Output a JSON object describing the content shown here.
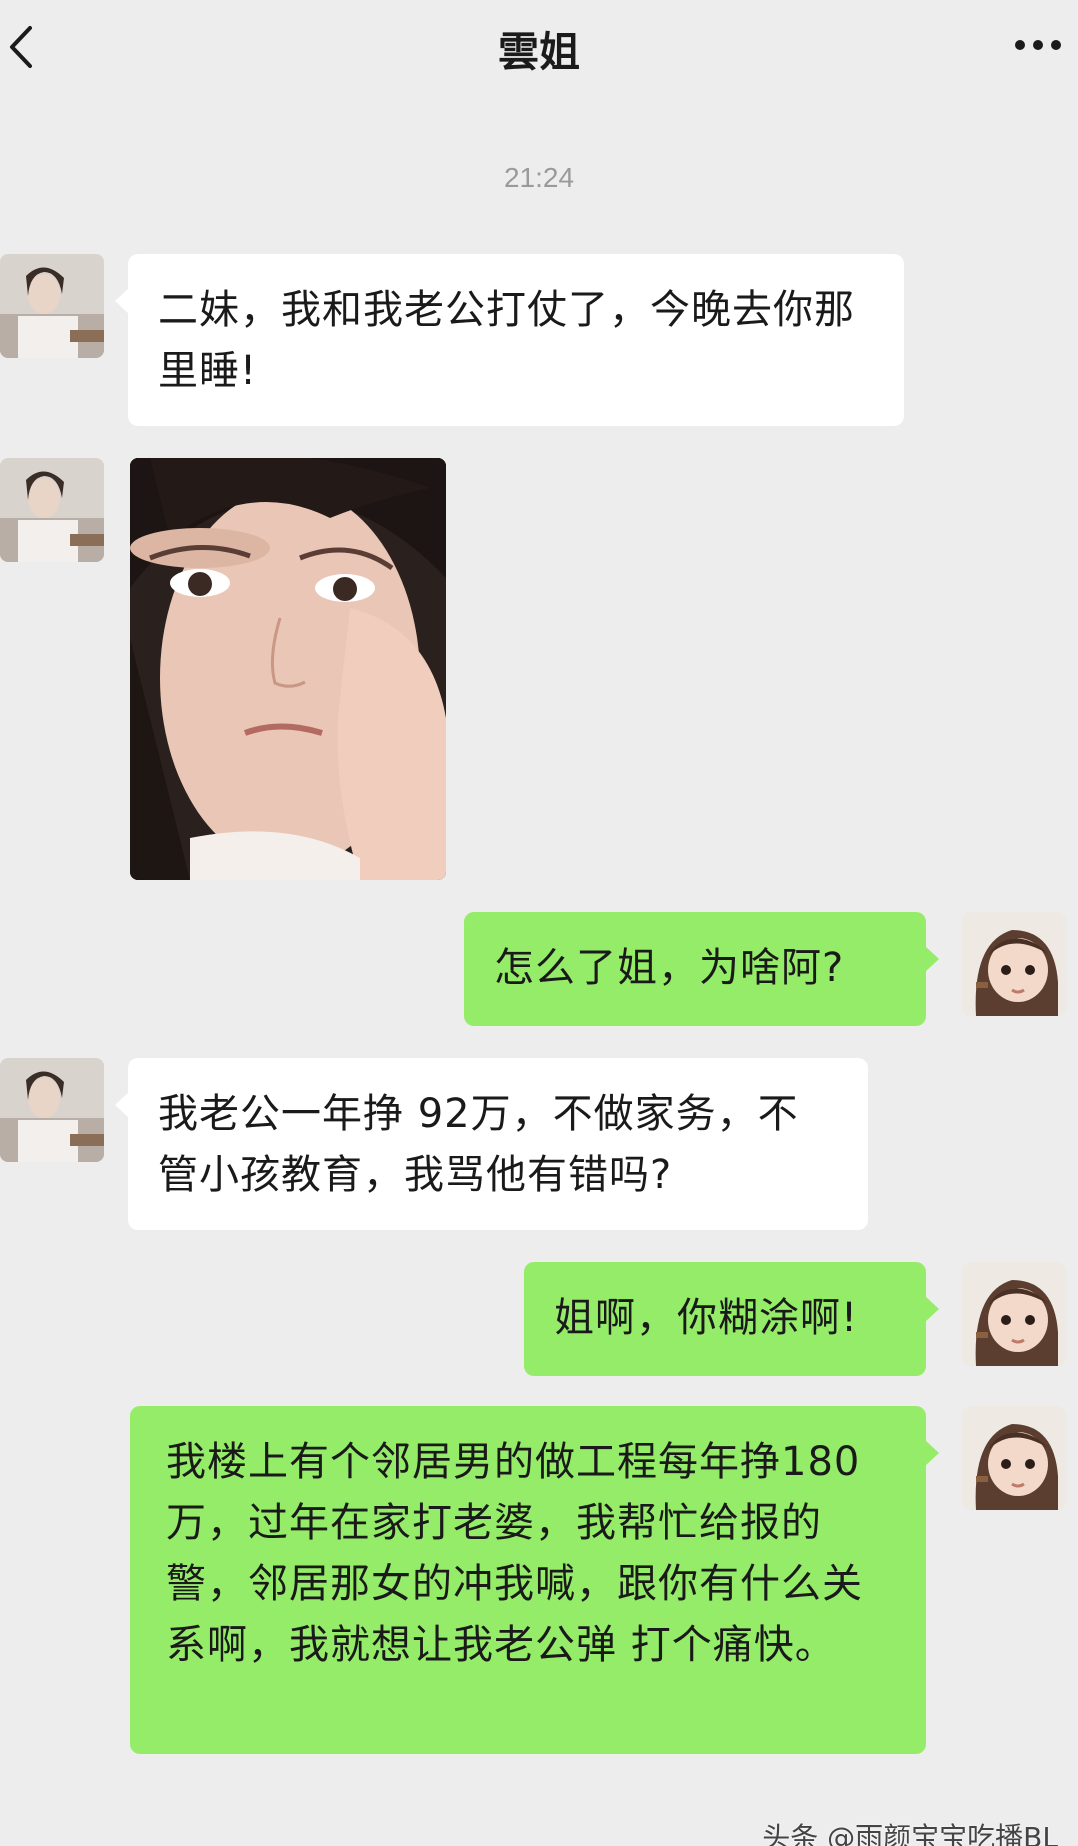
{
  "header": {
    "title": "雲姐",
    "back_icon": "chevron-left-icon",
    "more_icon": "more-dots-icon"
  },
  "timestamp": "21:24",
  "messages": [
    {
      "side": "left",
      "type": "text",
      "text": "二妹，我和我老公打仗了，今晚去你那里睡!"
    },
    {
      "side": "left",
      "type": "image",
      "description_icon": "photo"
    },
    {
      "side": "right",
      "type": "text",
      "text": "怎么了姐，为啥阿?"
    },
    {
      "side": "left",
      "type": "text",
      "text": "我老公一年挣 92万，不做家务，不管小孩教育，我骂他有错吗?"
    },
    {
      "side": "right",
      "type": "text",
      "text": "姐啊，你糊涂啊!"
    },
    {
      "side": "right",
      "type": "text",
      "text": "我楼上有个邻居男的做工程每年挣180万，过年在家打老婆，我帮忙给报的警，邻居那女的冲我喊，跟你有什么关系啊，我就想让我老公弹 打个痛快。"
    }
  ],
  "watermark": "头条 @雨颜宝宝吃播BL",
  "colors": {
    "background": "#ededed",
    "left_bubble": "#ffffff",
    "right_bubble": "#95ec69"
  }
}
